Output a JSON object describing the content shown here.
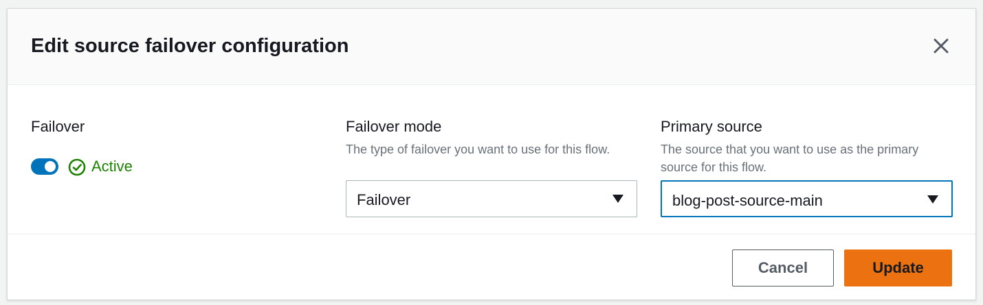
{
  "modal": {
    "title": "Edit source failover configuration"
  },
  "failover": {
    "label": "Failover",
    "toggle_on": true,
    "status": "Active"
  },
  "failover_mode": {
    "label": "Failover mode",
    "description": "The type of failover you want to use for this flow.",
    "selected": "Failover"
  },
  "primary_source": {
    "label": "Primary source",
    "description": "The source that you want to use as the primary source for this flow.",
    "selected": "blog-post-source-main"
  },
  "footer": {
    "cancel_label": "Cancel",
    "update_label": "Update"
  },
  "colors": {
    "accent": "#0073bb",
    "success": "#1d8102",
    "primary_button": "#ec7211"
  },
  "icons": {
    "close": "close-icon",
    "status": "check-circle-icon",
    "dropdown": "caret-down-icon"
  }
}
